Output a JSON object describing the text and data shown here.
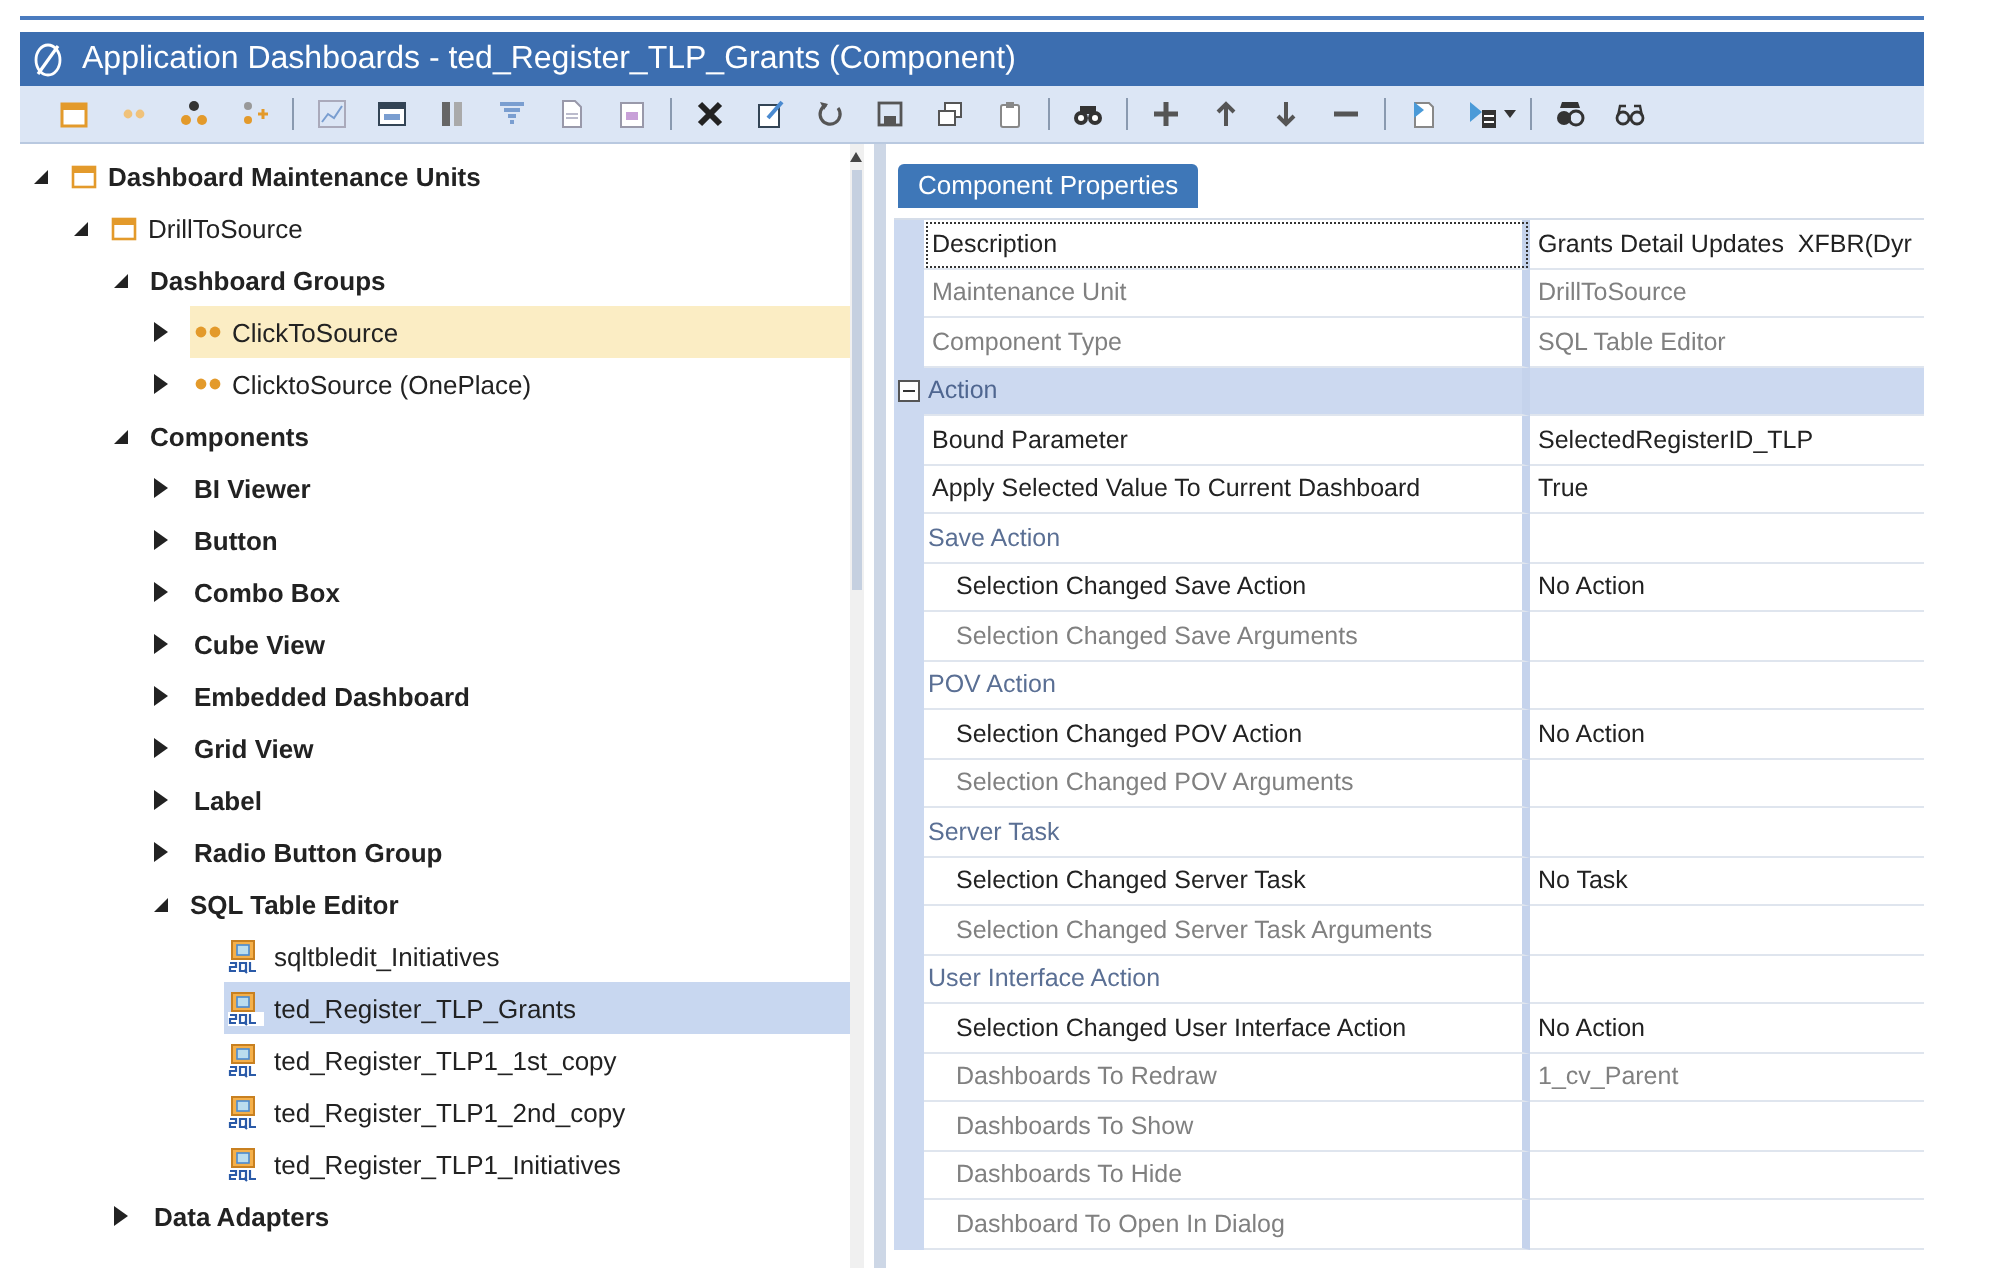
{
  "window": {
    "title": "Application Dashboards - ted_Register_TLP_Grants (Component)"
  },
  "tree": [
    {
      "label": "Dashboard Maintenance Units",
      "kind": "root",
      "expanded": true,
      "selected": false,
      "hovered": false,
      "children": [
        {
          "label": "DrillToSource",
          "kind": "unit",
          "expanded": true,
          "selected": false,
          "hovered": false,
          "children": [
            {
              "label": "Dashboard Groups",
              "kind": "category",
              "expanded": true,
              "selected": false,
              "hovered": false,
              "children": [
                {
                  "label": "ClickToSource",
                  "kind": "group",
                  "expanded": false,
                  "selected": false,
                  "hovered": true
                },
                {
                  "label": "ClicktoSource (OnePlace)",
                  "kind": "group",
                  "expanded": false,
                  "selected": false,
                  "hovered": false
                }
              ]
            },
            {
              "label": "Components",
              "kind": "category",
              "expanded": true,
              "selected": false,
              "hovered": false,
              "children": [
                {
                  "label": "BI Viewer",
                  "kind": "category",
                  "expanded": false,
                  "selected": false,
                  "hovered": false
                },
                {
                  "label": "Button",
                  "kind": "category",
                  "expanded": false,
                  "selected": false,
                  "hovered": false
                },
                {
                  "label": "Combo Box",
                  "kind": "category",
                  "expanded": false,
                  "selected": false,
                  "hovered": false
                },
                {
                  "label": "Cube View",
                  "kind": "category",
                  "expanded": false,
                  "selected": false,
                  "hovered": false
                },
                {
                  "label": "Embedded Dashboard",
                  "kind": "category",
                  "expanded": false,
                  "selected": false,
                  "hovered": false
                },
                {
                  "label": "Grid View",
                  "kind": "category",
                  "expanded": false,
                  "selected": false,
                  "hovered": false
                },
                {
                  "label": "Label",
                  "kind": "category",
                  "expanded": false,
                  "selected": false,
                  "hovered": false
                },
                {
                  "label": "Radio Button Group",
                  "kind": "category",
                  "expanded": false,
                  "selected": false,
                  "hovered": false
                },
                {
                  "label": "SQL Table Editor",
                  "kind": "category",
                  "expanded": true,
                  "selected": false,
                  "hovered": false,
                  "children": [
                    {
                      "label": "sqltbledit_Initiatives",
                      "kind": "sql",
                      "selected": false,
                      "hovered": false
                    },
                    {
                      "label": "ted_Register_TLP_Grants",
                      "kind": "sql",
                      "selected": true,
                      "hovered": false
                    },
                    {
                      "label": "ted_Register_TLP1_1st_copy",
                      "kind": "sql",
                      "selected": false,
                      "hovered": false
                    },
                    {
                      "label": "ted_Register_TLP1_2nd_copy",
                      "kind": "sql",
                      "selected": false,
                      "hovered": false
                    },
                    {
                      "label": "ted_Register_TLP1_Initiatives",
                      "kind": "sql",
                      "selected": false,
                      "hovered": false
                    }
                  ]
                }
              ]
            },
            {
              "label": "Data Adapters",
              "kind": "category",
              "expanded": false,
              "selected": false,
              "hovered": false
            }
          ]
        }
      ]
    }
  ],
  "properties": {
    "tab": "Component Properties",
    "rows": [
      {
        "kind": "property",
        "label": "Description",
        "value": "Grants Detail Updates  XFBR(Dyr",
        "selected": true
      },
      {
        "kind": "readonly",
        "label": "Maintenance Unit",
        "value": "DrillToSource",
        "selected": false
      },
      {
        "kind": "readonly",
        "label": "Component Type",
        "value": "SQL Table Editor",
        "selected": false
      },
      {
        "kind": "section",
        "label": "Action",
        "expanded": true,
        "selected": false,
        "children": [
          {
            "kind": "property",
            "label": "Bound Parameter",
            "value": "SelectedRegisterID_TLP",
            "selected": false
          },
          {
            "kind": "property",
            "label": "Apply Selected Value To Current Dashboard",
            "value": "True",
            "selected": false
          },
          {
            "kind": "category",
            "label": "Save Action",
            "selected": false,
            "children": [
              {
                "kind": "property",
                "label": "Selection Changed Save Action",
                "value": "No Action",
                "selected": false
              },
              {
                "kind": "readonly",
                "label": "Selection Changed Save Arguments",
                "selected": false
              }
            ]
          },
          {
            "kind": "category",
            "label": "POV Action",
            "selected": false,
            "children": [
              {
                "kind": "property",
                "label": "Selection Changed POV Action",
                "value": "No Action",
                "selected": false
              },
              {
                "kind": "readonly",
                "label": "Selection Changed POV Arguments",
                "selected": false
              }
            ]
          },
          {
            "kind": "category",
            "label": "Server Task",
            "selected": false,
            "children": [
              {
                "kind": "property",
                "label": "Selection Changed Server Task",
                "value": "No Task",
                "selected": false
              },
              {
                "kind": "readonly",
                "label": "Selection Changed Server Task Arguments",
                "selected": false
              }
            ]
          },
          {
            "kind": "category",
            "label": "User Interface Action",
            "selected": false,
            "children": [
              {
                "kind": "property",
                "label": "Selection Changed User Interface Action",
                "value": "No Action",
                "selected": false
              },
              {
                "kind": "readonly",
                "label": "Dashboards To Redraw",
                "value": "1_cv_Parent",
                "selected": false
              },
              {
                "kind": "readonly",
                "label": "Dashboards To Show",
                "selected": false
              },
              {
                "kind": "readonly",
                "label": "Dashboards To Hide",
                "selected": false
              },
              {
                "kind": "readonly",
                "label": "Dashboard To Open In Dialog",
                "selected": false
              }
            ]
          }
        ]
      }
    ]
  }
}
